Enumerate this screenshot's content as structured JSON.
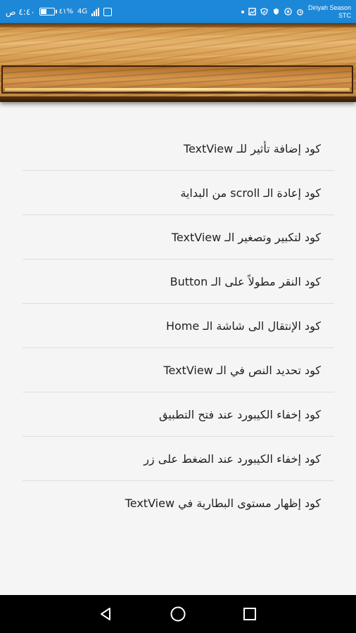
{
  "status_bar": {
    "time": "٤:٤٠ ص",
    "battery_percent_text": "٤١%",
    "network_type": "4G",
    "carrier_line1": "Diriyah Season",
    "carrier_line2": "STC"
  },
  "list": {
    "items": [
      "كود إضافة تأثير للـ TextView",
      "كود إعادة الـ scroll من البداية",
      "كود لتكبير وتصغير الـ TextView",
      "كود النقر مطولاً على الـ Button",
      "كود الإنتقال الى شاشة الـ Home",
      "كود تحديد النص في الـ TextView",
      "كود إخفاء الكيبورد عند فتح التطبيق",
      "كود إخفاء الكيبورد عند الضغط على زر",
      "كود إظهار مستوى البطارية في TextView"
    ]
  },
  "navigation": {
    "icons": [
      "back-icon",
      "home-icon",
      "recents-icon"
    ]
  }
}
